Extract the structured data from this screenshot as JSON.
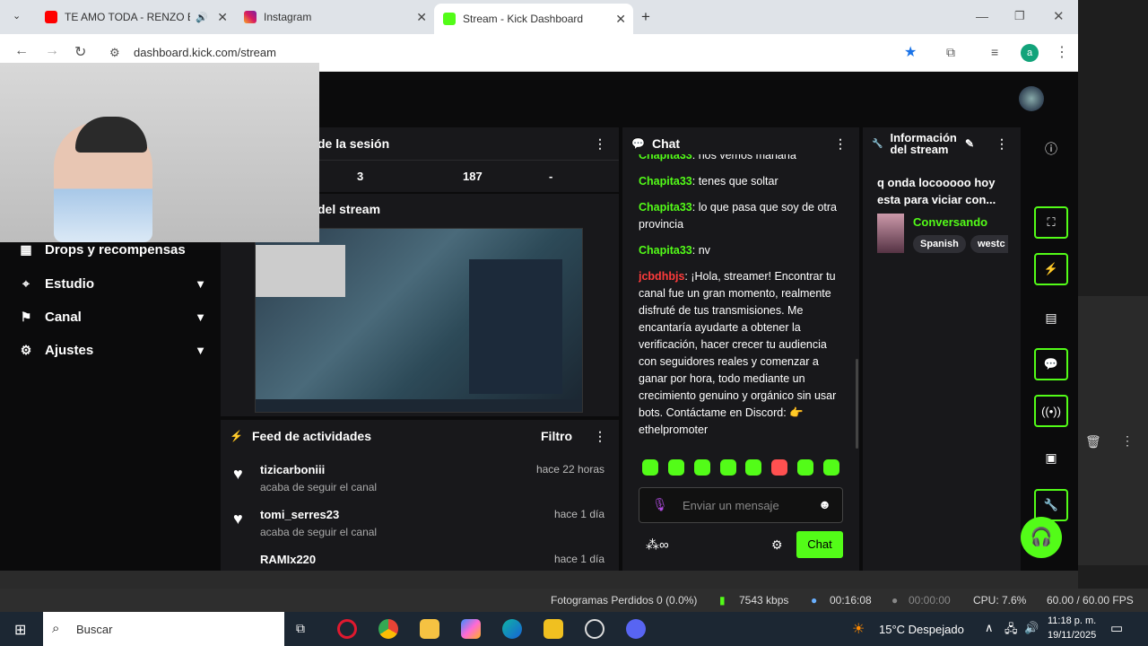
{
  "browser": {
    "tabs": [
      {
        "title": "TE AMO TODA - RENZO ED",
        "favicon": "youtube-icon"
      },
      {
        "title": "Instagram",
        "favicon": "instagram-icon"
      },
      {
        "title": "Stream - Kick Dashboard",
        "favicon": "kick-icon"
      }
    ],
    "url": "dashboard.kick.com/stream",
    "profile_initial": "a"
  },
  "sidebar": {
    "items": [
      {
        "label": "Drops y recompensas"
      },
      {
        "label": "Estudio"
      },
      {
        "label": "Canal"
      },
      {
        "label": "Ajustes"
      }
    ]
  },
  "session": {
    "title": "de la sesión",
    "stats": [
      "3",
      "187",
      "-"
    ]
  },
  "preview": {
    "title": "del stream"
  },
  "feed": {
    "title": "Feed de actividades",
    "filter_label": "Filtro",
    "items": [
      {
        "user": "tizicarboniii",
        "action": "acaba de seguir el canal",
        "time": "hace 22 horas"
      },
      {
        "user": "tomi_serres23",
        "action": "acaba de seguir el canal",
        "time": "hace 1 día"
      },
      {
        "user": "RAMIx220",
        "action": "",
        "time": "hace 1 día"
      }
    ]
  },
  "chat": {
    "title": "Chat",
    "messages": [
      {
        "user": "Chapita33",
        "text": "nos vemos mañana"
      },
      {
        "user": "Chapita33",
        "text": "tenes que soltar"
      },
      {
        "user": "Chapita33",
        "text": "lo que pasa que soy de otra provincia"
      },
      {
        "user": "Chapita33",
        "text": "nv"
      },
      {
        "user": "jcbdhbjs",
        "text": "¡Hola, streamer! Encontrar tu canal fue un gran momento, realmente disfruté de tus transmisiones. Me encantaría ayudarte a obtener la verificación, hacer crecer tu audiencia con seguidores reales y comenzar a ganar por hora, todo mediante un crecimiento genuino y orgánico sin usar bots. Contáctame en Discord: 👉 ethelpromoter"
      }
    ],
    "input_placeholder": "Enviar un mensaje",
    "send_label": "Chat"
  },
  "stream_info": {
    "title_line1": "Información",
    "title_line2": "del stream",
    "stream_title": "q onda locooooo hoy esta para viciar con...",
    "category": "Conversando",
    "tags": [
      "Spanish",
      "westc"
    ]
  },
  "obs_status": {
    "dropped": "Fotogramas Perdidos 0 (0.0%)",
    "bitrate": "7543 kbps",
    "live_time": "00:16:08",
    "rec_time": "00:00:00",
    "cpu": "CPU: 7.6%",
    "fps": "60.00 / 60.00 FPS"
  },
  "taskbar": {
    "search": "Buscar",
    "weather": "15°C  Despejado",
    "time": "11:18 p. m.",
    "date": "19/11/2025"
  },
  "colors": {
    "accent": "#53fc18",
    "panel": "#18181b",
    "bg": "#0b0b0c",
    "chat_user2": "#ff3b3b"
  }
}
